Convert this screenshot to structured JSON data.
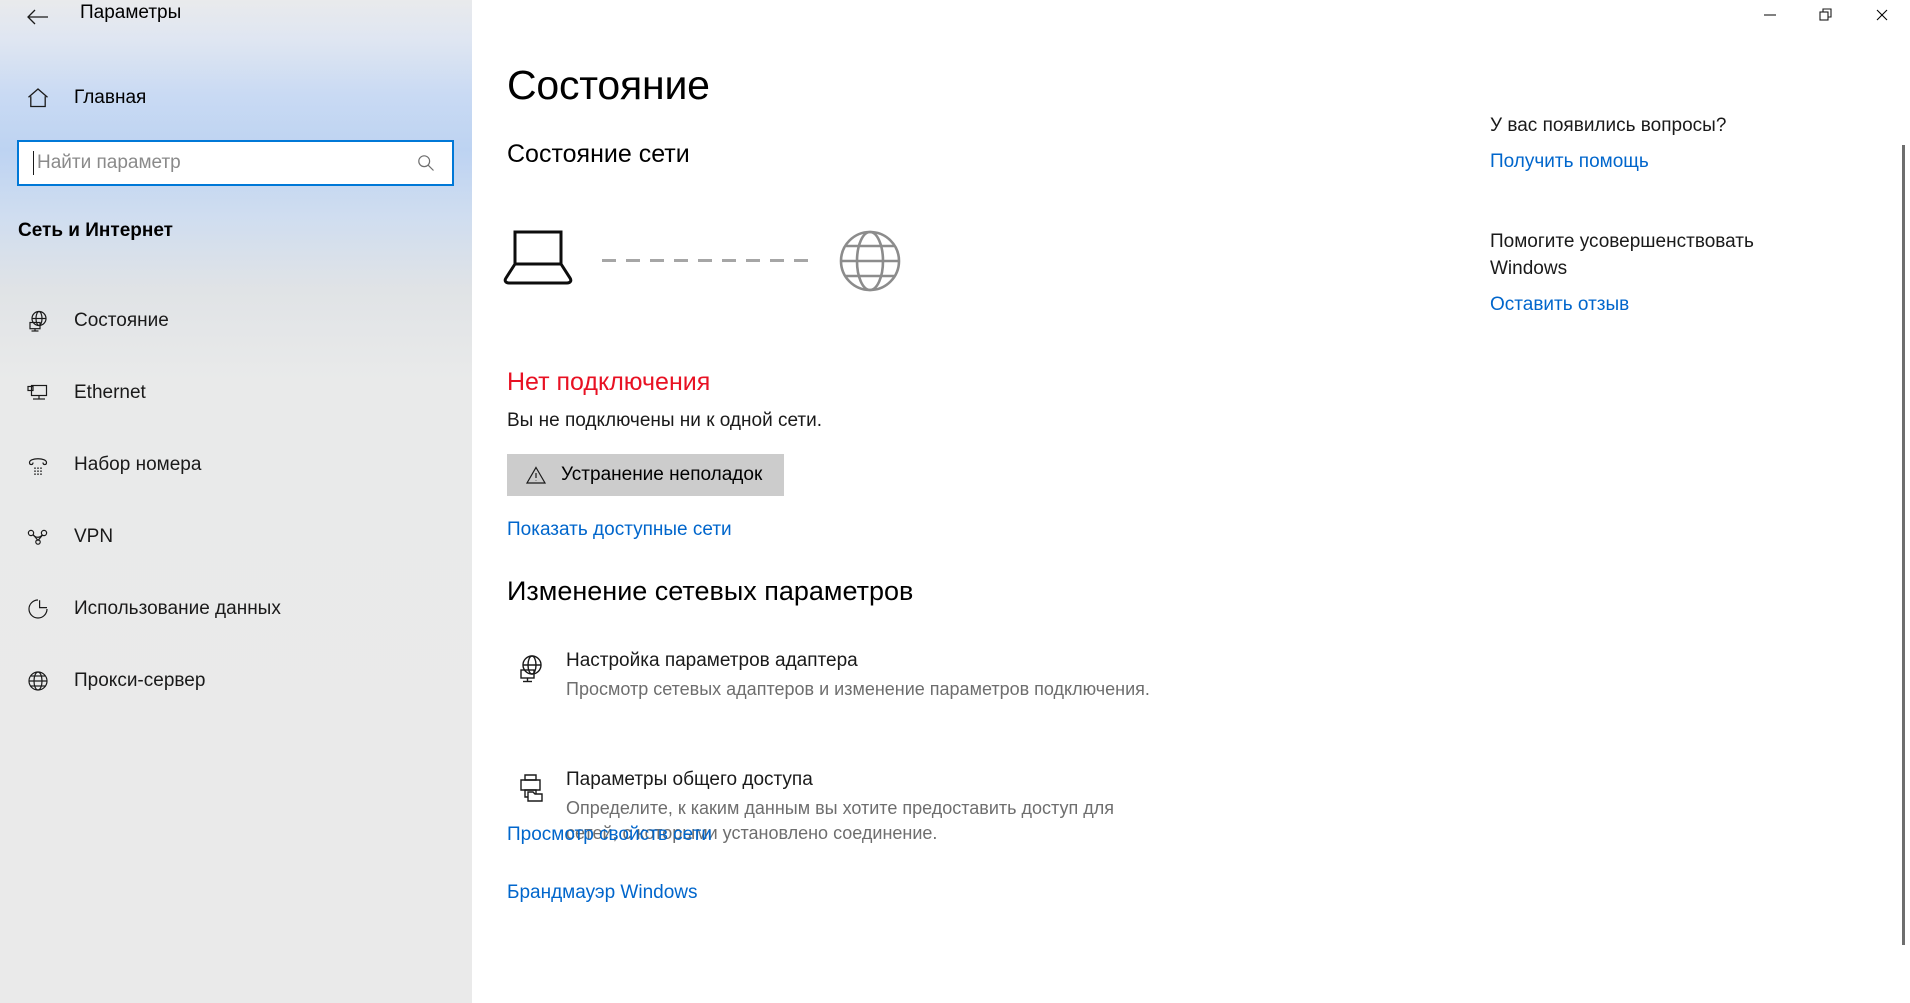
{
  "window": {
    "app_title": "Параметры",
    "back_icon": "back-arrow-icon",
    "controls": {
      "minimize": "minimize-icon",
      "restore": "restore-icon",
      "close": "close-icon"
    }
  },
  "sidebar": {
    "home": {
      "label": "Главная",
      "icon": "home-icon"
    },
    "search": {
      "placeholder": "Найти параметр",
      "value": "",
      "icon": "search-icon"
    },
    "category": "Сеть и Интернет",
    "items": [
      {
        "label": "Состояние",
        "icon": "network-status-icon"
      },
      {
        "label": "Ethernet",
        "icon": "ethernet-icon"
      },
      {
        "label": "Набор номера",
        "icon": "dial-up-icon"
      },
      {
        "label": "VPN",
        "icon": "vpn-icon"
      },
      {
        "label": "Использование данных",
        "icon": "data-usage-icon"
      },
      {
        "label": "Прокси-сервер",
        "icon": "proxy-globe-icon"
      }
    ]
  },
  "main": {
    "page_title": "Состояние",
    "network_status_heading": "Состояние сети",
    "diagram": {
      "device_icon": "laptop-icon",
      "internet_icon": "globe-icon",
      "link_state": "disconnected"
    },
    "status": {
      "title": "Нет подключения",
      "title_color": "#e81123",
      "description": "Вы не подключены ни к одной сети."
    },
    "troubleshoot_button": {
      "label": "Устранение неполадок",
      "icon": "warning-triangle-icon"
    },
    "show_networks_link": "Показать доступные сети",
    "change_settings_heading": "Изменение сетевых параметров",
    "options": [
      {
        "title": "Настройка параметров адаптера",
        "description": "Просмотр сетевых адаптеров и изменение параметров подключения.",
        "icon": "adapter-globe-icon"
      },
      {
        "title": "Параметры общего доступа",
        "description": "Определите, к каким данным вы хотите предоставить доступ для сетей, с которыми установлено соединение.",
        "icon": "sharing-printer-folder-icon"
      }
    ],
    "network_properties_link": "Просмотр свойств сети",
    "firewall_link": "Брандмауэр Windows"
  },
  "help_panel": {
    "questions_heading": "У вас появились вопросы?",
    "get_help_link": "Получить помощь",
    "improve_heading": "Помогите усовершенствовать Windows",
    "feedback_link": "Оставить отзыв"
  },
  "colors": {
    "accent_link": "#0066cc",
    "error": "#e81123",
    "search_border": "#0078d7",
    "button_bg": "#cccccc"
  }
}
